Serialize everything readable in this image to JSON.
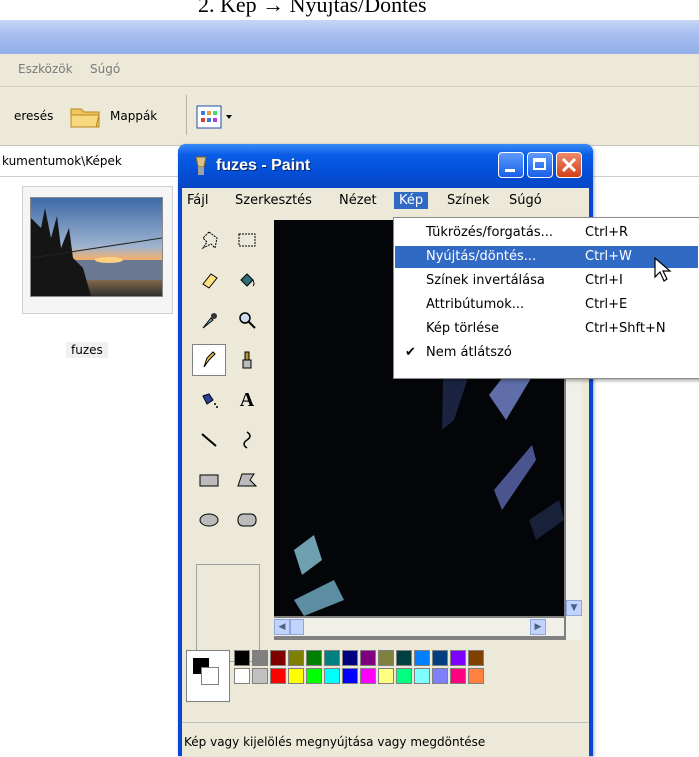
{
  "caption": "2. Kép → Nyújtás/Döntés",
  "explorer": {
    "menu": [
      "Eszközök",
      "Súgó"
    ],
    "toolbar": {
      "search_label": "eresés",
      "folders_label": "Mappák"
    },
    "address": "kumentumok\\Képek",
    "thumbnail_label": "fuzes"
  },
  "paint": {
    "title": "fuzes - Paint",
    "menu": [
      "Fájl",
      "Szerkesztés",
      "Nézet",
      "Kép",
      "Színek",
      "Súgó"
    ],
    "status": "Kép vagy kijelölés megnyújtása vagy megdöntése"
  },
  "kep_menu": [
    {
      "label": "Tükrözés/forgatás...",
      "shortcut": "Ctrl+R",
      "checked": false,
      "highlighted": false
    },
    {
      "label": "Nyújtás/döntés...",
      "shortcut": "Ctrl+W",
      "checked": false,
      "highlighted": true
    },
    {
      "label": "Színek invertálása",
      "shortcut": "Ctrl+I",
      "checked": false,
      "highlighted": false
    },
    {
      "label": "Attribútumok...",
      "shortcut": "Ctrl+E",
      "checked": false,
      "highlighted": false
    },
    {
      "label": "Kép törlése",
      "shortcut": "Ctrl+Shft+N",
      "checked": false,
      "highlighted": false
    },
    {
      "label": "Nem átlátszó",
      "shortcut": "",
      "checked": true,
      "highlighted": false
    }
  ],
  "palette_colors": [
    "#000000",
    "#808080",
    "#800000",
    "#808000",
    "#008000",
    "#008080",
    "#000080",
    "#800080",
    "#808040",
    "#004040",
    "#0080ff",
    "#004080",
    "#8000ff",
    "#804000",
    "#ffffff",
    "#c0c0c0",
    "#ff0000",
    "#ffff00",
    "#00ff00",
    "#00ffff",
    "#0000ff",
    "#ff00ff",
    "#ffff80",
    "#00ff80",
    "#80ffff",
    "#8080ff",
    "#ff0080",
    "#ff8040"
  ],
  "colors": {
    "paint_title_blue": "#0a5ce6",
    "menu_highlight": "#316ac5",
    "close_red": "#d2401a"
  }
}
